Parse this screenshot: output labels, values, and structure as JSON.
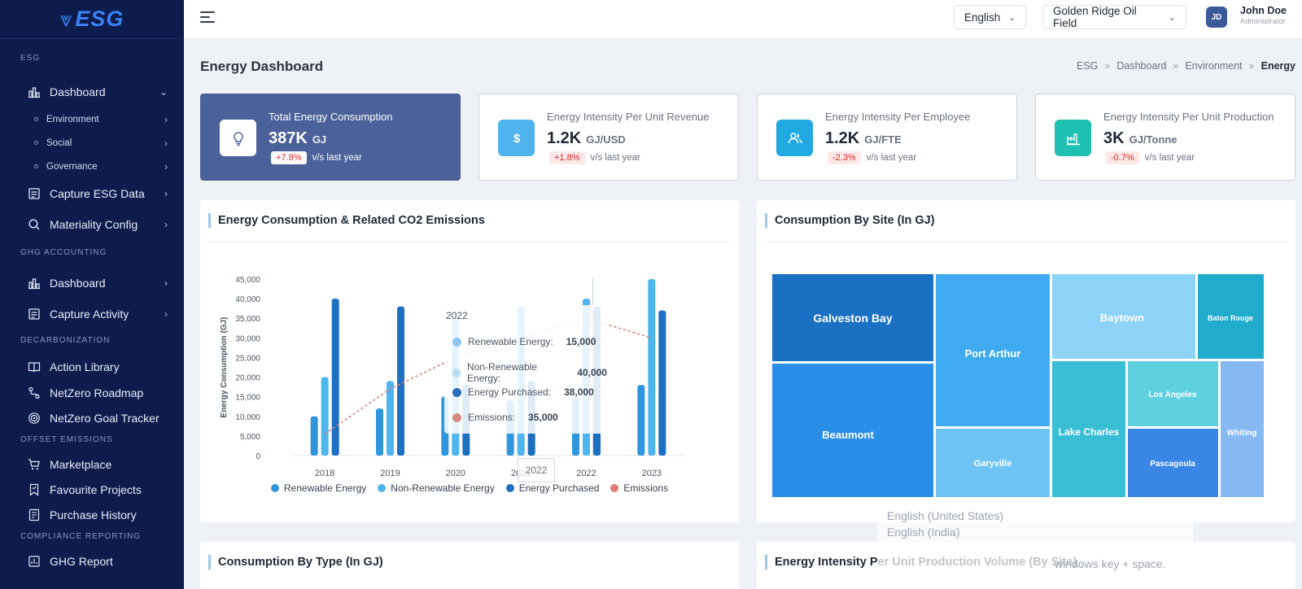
{
  "app": {
    "logo_text": "ESG"
  },
  "sidebar": {
    "sections": {
      "esg": "ESG",
      "ghg": "GHG ACCOUNTING",
      "decarb": "DECARBONIZATION",
      "offset": "OFFSET EMISSIONS",
      "compliance": "COMPLIANCE REPORTING"
    },
    "items": {
      "dashboard": "Dashboard",
      "environment": "Environment",
      "social": "Social",
      "governance": "Governance",
      "capture_esg": "Capture ESG Data",
      "materiality": "Materiality Config",
      "ghg_dashboard": "Dashboard",
      "capture_activity": "Capture Activity",
      "action_library": "Action Library",
      "netzero_roadmap": "NetZero Roadmap",
      "netzero_goal": "NetZero Goal Tracker",
      "marketplace": "Marketplace",
      "favourite_projects": "Favourite Projects",
      "purchase_history": "Purchase History",
      "ghg_report": "GHG Report"
    }
  },
  "header": {
    "language": "English",
    "site": "Golden Ridge Oil Field",
    "user_initials": "JD",
    "user_name": "John Doe",
    "user_role": "Administrator"
  },
  "page": {
    "title": "Energy Dashboard",
    "breadcrumb": [
      "ESG",
      "Dashboard",
      "Environment",
      "Energy"
    ],
    "breadcrumb_sep": "»"
  },
  "kpis": [
    {
      "title": "Total Energy Consumption",
      "value": "387K",
      "unit": "GJ",
      "delta": "+7.8%",
      "delta_note": "v/s last year"
    },
    {
      "title": "Energy Intensity Per Unit Revenue",
      "value": "1.2K",
      "unit": "GJ/USD",
      "delta": "+1.8%",
      "delta_note": "v/s last year",
      "icon_color": "#4fb3ee"
    },
    {
      "title": "Energy Intensity Per Employee",
      "value": "1.2K",
      "unit": "GJ/FTE",
      "delta": "-2.3%",
      "delta_note": "v/s last year",
      "icon_color": "#21a9e1"
    },
    {
      "title": "Energy Intensity Per Unit Production",
      "value": "3K",
      "unit": "GJ/Tonne",
      "delta": "-0.7%",
      "delta_note": "v/s last year",
      "icon_color": "#20c0b4"
    }
  ],
  "panels": {
    "energy_co2": "Energy Consumption & Related CO2 Emissions",
    "by_site": "Consumption By Site (In GJ)",
    "by_type": "Consumption By Type (In GJ)",
    "intensity_by_site": "Energy Intensity Per Unit Production Volume (By Site)"
  },
  "tooltip": {
    "title": "2022",
    "axis_label": "2022",
    "rows": [
      {
        "label": "Renewable Energy:",
        "value": "15,000"
      },
      {
        "label": "Non-Renewable Energy:",
        "value": "40,000"
      },
      {
        "label": "Energy Purchased:",
        "value": "38,000"
      },
      {
        "label": "Emissions:",
        "value": "35,000"
      }
    ]
  },
  "chart_data": [
    {
      "type": "bar",
      "title": "Energy Consumption & Related CO2 Emissions",
      "ylabel": "Energy Consumption (GJ)",
      "xlabel": "",
      "categories": [
        "2018",
        "2019",
        "2020",
        "2021",
        "2022",
        "2023"
      ],
      "ylim": [
        0,
        45000
      ],
      "yticks": [
        "0",
        "5,000",
        "10,000",
        "15,000",
        "20,000",
        "25,000",
        "30,000",
        "35,000",
        "40,000",
        "45,000"
      ],
      "grid": false,
      "legend": "bottom",
      "series": [
        {
          "name": "Renewable Energy",
          "color": "#2f95dc",
          "values": [
            10000,
            12000,
            15000,
            14000,
            15000,
            18000
          ]
        },
        {
          "name": "Non-Renewable Energy",
          "color": "#4eb5ee",
          "values": [
            20000,
            19000,
            35000,
            38000,
            40000,
            45000
          ]
        },
        {
          "name": "Energy Purchased",
          "color": "#1c6fc1",
          "values": [
            40000,
            38000,
            18000,
            19000,
            38000,
            37000
          ]
        },
        {
          "name": "Emissions",
          "color": "#e07b73",
          "type": "line",
          "values": [
            5500,
            17000,
            25000,
            30000,
            35000,
            30000
          ]
        }
      ]
    },
    {
      "type": "treemap",
      "title": "Consumption By Site (In GJ)",
      "items": [
        {
          "name": "Galveston Bay",
          "color": "#1a71c4"
        },
        {
          "name": "Beaumont",
          "color": "#2a8ee8"
        },
        {
          "name": "Port Arthur",
          "color": "#40aaf0"
        },
        {
          "name": "Garyville",
          "color": "#6dc3f4"
        },
        {
          "name": "Baytown",
          "color": "#8dd3f7"
        },
        {
          "name": "Lake Charles",
          "color": "#38bfd6"
        },
        {
          "name": "Los Angeles",
          "color": "#5fd0df"
        },
        {
          "name": "Pascagoula",
          "color": "#3a86e6"
        },
        {
          "name": "Baton Rouge",
          "color": "#21abcc"
        },
        {
          "name": "Whiting",
          "color": "#86b8f2"
        }
      ]
    }
  ],
  "overlay": {
    "options": [
      "English (United States)",
      "English (India)"
    ],
    "hint": "windows key + space."
  }
}
